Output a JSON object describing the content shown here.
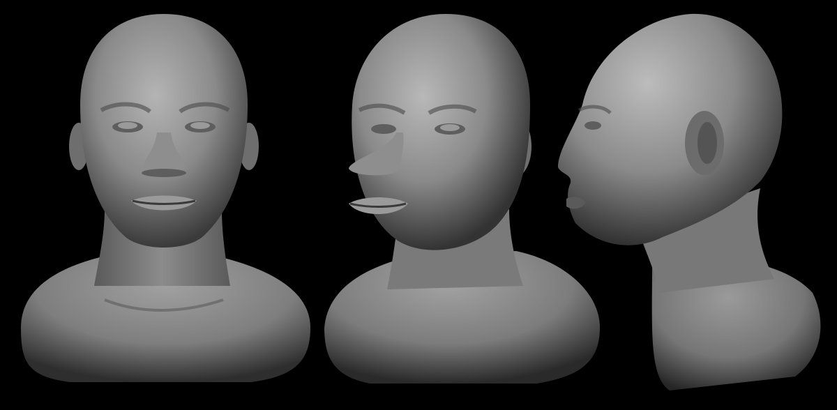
{
  "scene": {
    "background": "#000000",
    "material": {
      "highlight": "#bdbdbd",
      "mid": "#8a8a8a",
      "shadow": "#3a3a3a",
      "deep": "#1c1c1c"
    },
    "views": [
      {
        "id": "front",
        "orientation": "front"
      },
      {
        "id": "three-quarter",
        "orientation": "three-quarter-left"
      },
      {
        "id": "profile",
        "orientation": "profile-left"
      }
    ]
  }
}
